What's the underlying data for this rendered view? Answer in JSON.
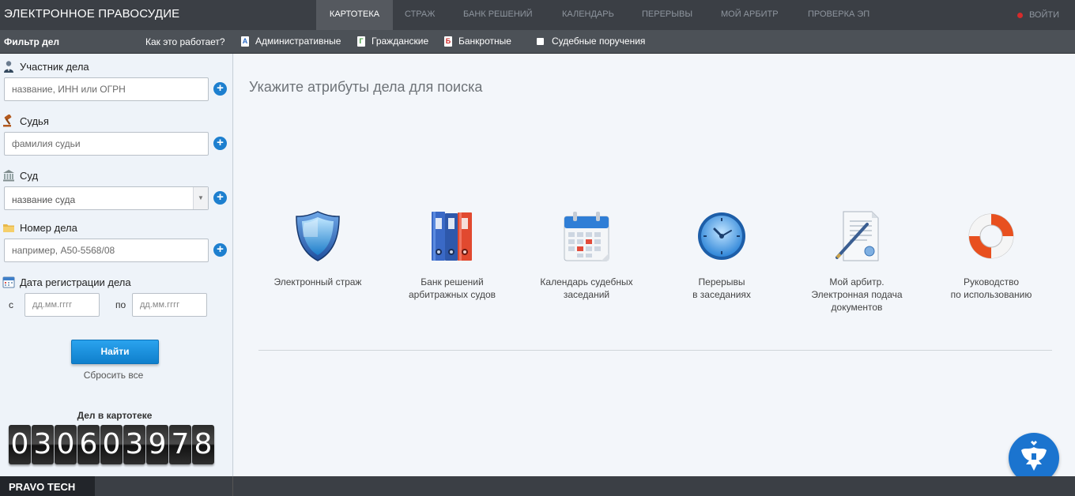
{
  "header": {
    "brand": "ЭЛЕКТРОННОЕ ПРАВОСУДИЕ",
    "nav": [
      {
        "label": "КАРТОТЕКА",
        "active": true
      },
      {
        "label": "СТРАЖ",
        "active": false
      },
      {
        "label": "БАНК РЕШЕНИЙ",
        "active": false
      },
      {
        "label": "КАЛЕНДАРЬ",
        "active": false
      },
      {
        "label": "ПЕРЕРЫВЫ",
        "active": false
      },
      {
        "label": "МОЙ АРБИТР",
        "active": false
      },
      {
        "label": "ПРОВЕРКА ЭП",
        "active": false
      }
    ],
    "logout": "ВОЙТИ"
  },
  "filterbar": {
    "title": "Фильтр дел",
    "howto": "Как это работает?",
    "types": [
      {
        "badge": "А",
        "label": "Административные"
      },
      {
        "badge": "Г",
        "label": "Гражданские"
      },
      {
        "badge": "Б",
        "label": "Банкротные"
      },
      {
        "badge": "",
        "label": "Судебные поручения"
      }
    ]
  },
  "sidebar": {
    "participant": {
      "label": "Участник дела",
      "placeholder": "название, ИНН или ОГРН"
    },
    "judge": {
      "label": "Судья",
      "placeholder": "фамилия судьи"
    },
    "court": {
      "label": "Суд",
      "value": "название суда"
    },
    "case_number": {
      "label": "Номер дела",
      "placeholder": "например, А50-5568/08"
    },
    "date": {
      "label": "Дата регистрации дела",
      "from_label": "с",
      "to_label": "по",
      "from_placeholder": "дд.мм.гггг",
      "to_placeholder": "дд.мм.гггг"
    },
    "find_button": "Найти",
    "reset": "Сбросить все",
    "count_title": "Дел в картотеке",
    "count_digits": [
      "0",
      "3",
      "0",
      "6",
      "0",
      "3",
      "9",
      "7",
      "8"
    ]
  },
  "main": {
    "headline": "Укажите атрибуты дела для поиска",
    "services": [
      {
        "icon": "shield-icon",
        "lines": [
          "Электронный страж"
        ]
      },
      {
        "icon": "binders-icon",
        "lines": [
          "Банк решений",
          "арбитражных судов"
        ]
      },
      {
        "icon": "calendar-icon",
        "lines": [
          "Календарь судебных",
          "заседаний"
        ]
      },
      {
        "icon": "clock-icon",
        "lines": [
          "Перерывы",
          "в заседаниях"
        ]
      },
      {
        "icon": "document-pen-icon",
        "lines": [
          "Мой арбитр.",
          "Электронная подача",
          "документов"
        ]
      },
      {
        "icon": "lifebuoy-icon",
        "lines": [
          "Руководство",
          "по использованию"
        ]
      }
    ]
  },
  "footer": {
    "brand": "PRAVO TECH"
  }
}
